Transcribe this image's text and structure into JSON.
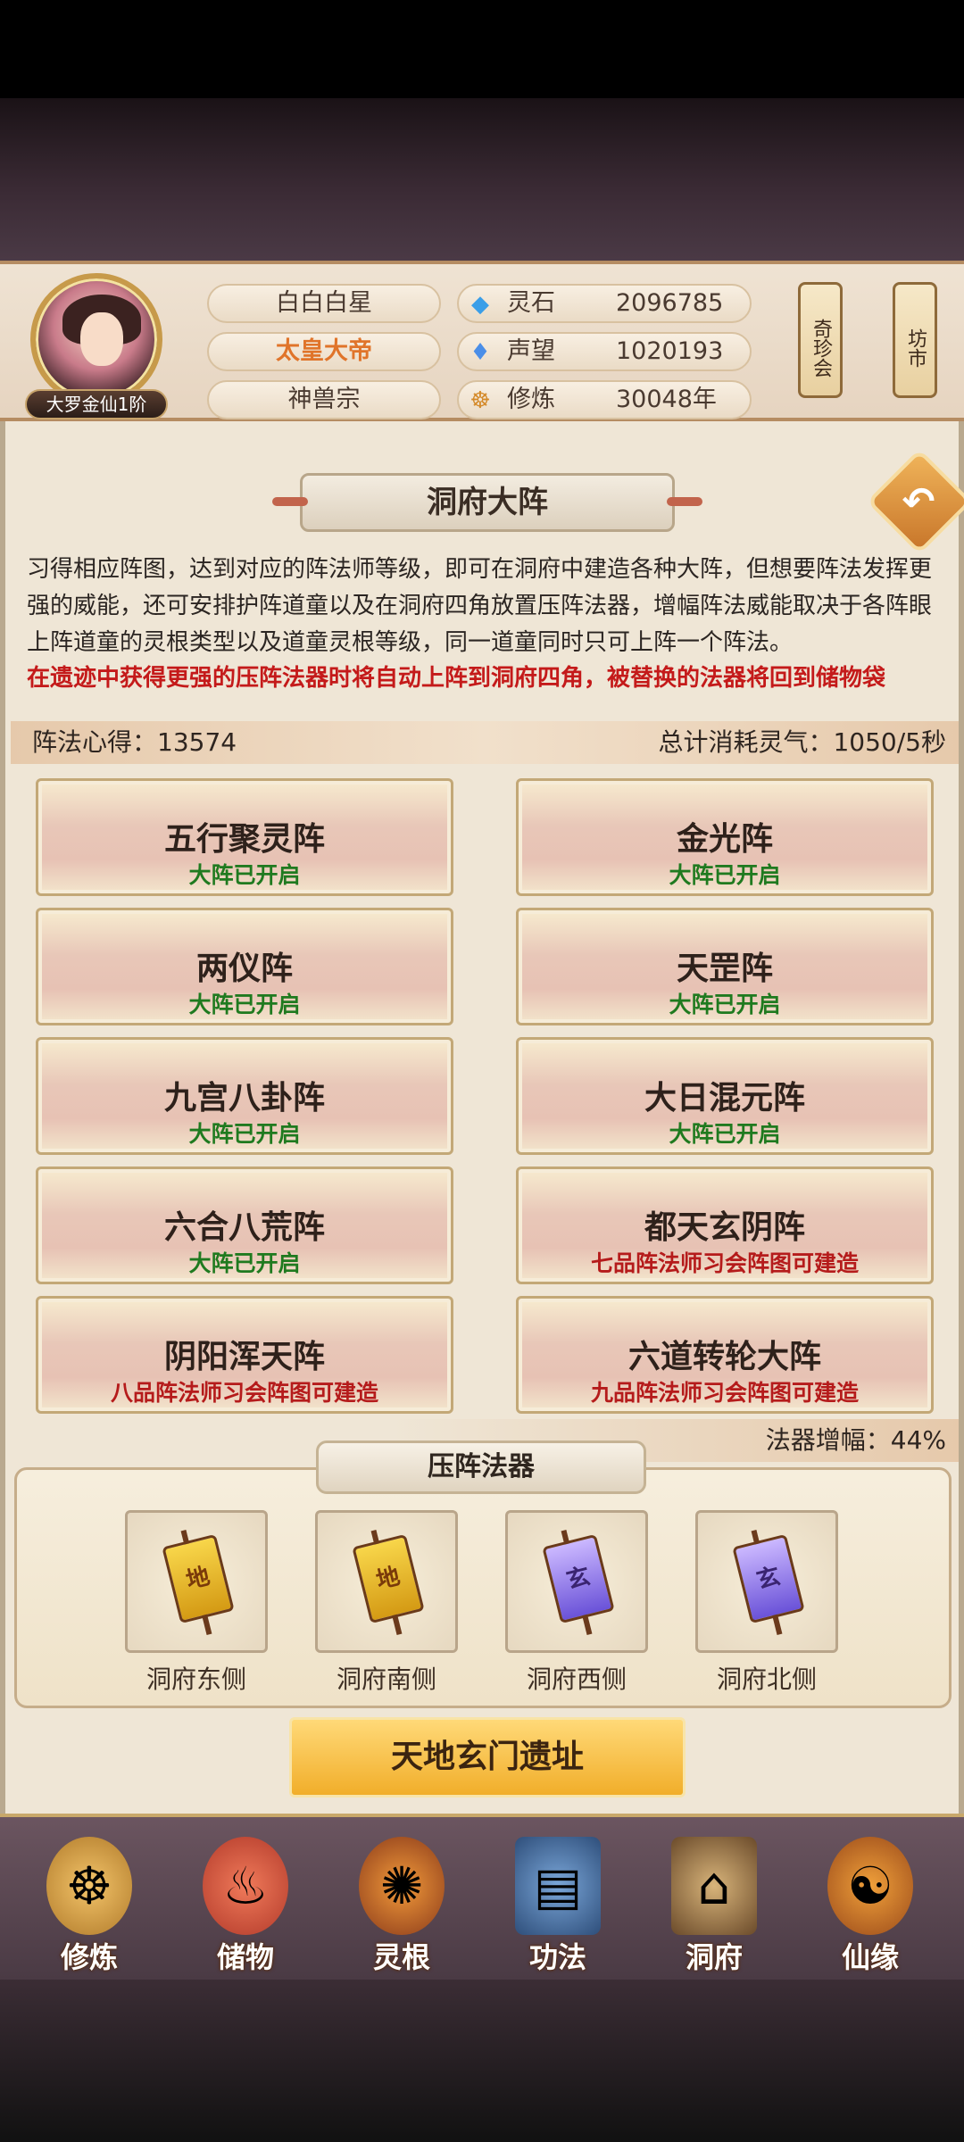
{
  "player": {
    "rank": "大罗金仙1阶",
    "name": "白白白星",
    "title": "太皇大帝",
    "sect": "神兽宗"
  },
  "resources": [
    {
      "icon": "spirit-stone-icon",
      "label": "灵石",
      "value": "2096785"
    },
    {
      "icon": "prestige-icon",
      "label": "声望",
      "value": "1020193"
    },
    {
      "icon": "cultivation-icon",
      "label": "修炼",
      "value": "30048年"
    }
  ],
  "side_buttons": {
    "treasure": "奇珍会",
    "market": "坊市"
  },
  "page_title": "洞府大阵",
  "description": "习得相应阵图，达到对应的阵法师等级，即可在洞府中建造各种大阵，但想要阵法发挥更强的威能，还可安排护阵道童以及在洞府四角放置压阵法器，增幅阵法威能取决于各阵眼上阵道童的灵根类型以及道童灵根等级，同一道童同时只可上阵一个阵法。",
  "warning": "在遗迹中获得更强的压阵法器时将自动上阵到洞府四角，被替换的法器将回到储物袋",
  "stats": {
    "insight_label": "阵法心得：",
    "insight_value": "13574",
    "consumption_label": "总计消耗灵气：",
    "consumption_value": "1050/5秒"
  },
  "formations": [
    {
      "name": "五行聚灵阵",
      "status": "大阵已开启",
      "open": true
    },
    {
      "name": "金光阵",
      "status": "大阵已开启",
      "open": true
    },
    {
      "name": "两仪阵",
      "status": "大阵已开启",
      "open": true
    },
    {
      "name": "天罡阵",
      "status": "大阵已开启",
      "open": true
    },
    {
      "name": "九宫八卦阵",
      "status": "大阵已开启",
      "open": true
    },
    {
      "name": "大日混元阵",
      "status": "大阵已开启",
      "open": true
    },
    {
      "name": "六合八荒阵",
      "status": "大阵已开启",
      "open": true
    },
    {
      "name": "都天玄阴阵",
      "status": "七品阵法师习会阵图可建造",
      "open": false
    },
    {
      "name": "阴阳浑天阵",
      "status": "八品阵法师习会阵图可建造",
      "open": false
    },
    {
      "name": "六道转轮大阵",
      "status": "九品阵法师习会阵图可建造",
      "open": false
    }
  ],
  "boost": {
    "label": "法器增幅：",
    "value": "44%"
  },
  "artifacts": {
    "title": "压阵法器",
    "slots": [
      {
        "label": "洞府东侧",
        "flag": "地",
        "color": "gold"
      },
      {
        "label": "洞府南侧",
        "flag": "地",
        "color": "gold"
      },
      {
        "label": "洞府西侧",
        "flag": "玄",
        "color": "purple"
      },
      {
        "label": "洞府北侧",
        "flag": "玄",
        "color": "purple"
      }
    ]
  },
  "action_button": "天地玄门遗址",
  "nav": [
    {
      "label": "修炼",
      "icon": "monk-icon"
    },
    {
      "label": "储物",
      "icon": "bag-icon"
    },
    {
      "label": "灵根",
      "icon": "spirit-root-icon"
    },
    {
      "label": "功法",
      "icon": "book-icon"
    },
    {
      "label": "洞府",
      "icon": "cave-house-icon"
    },
    {
      "label": "仙缘",
      "icon": "gourd-icon"
    }
  ]
}
